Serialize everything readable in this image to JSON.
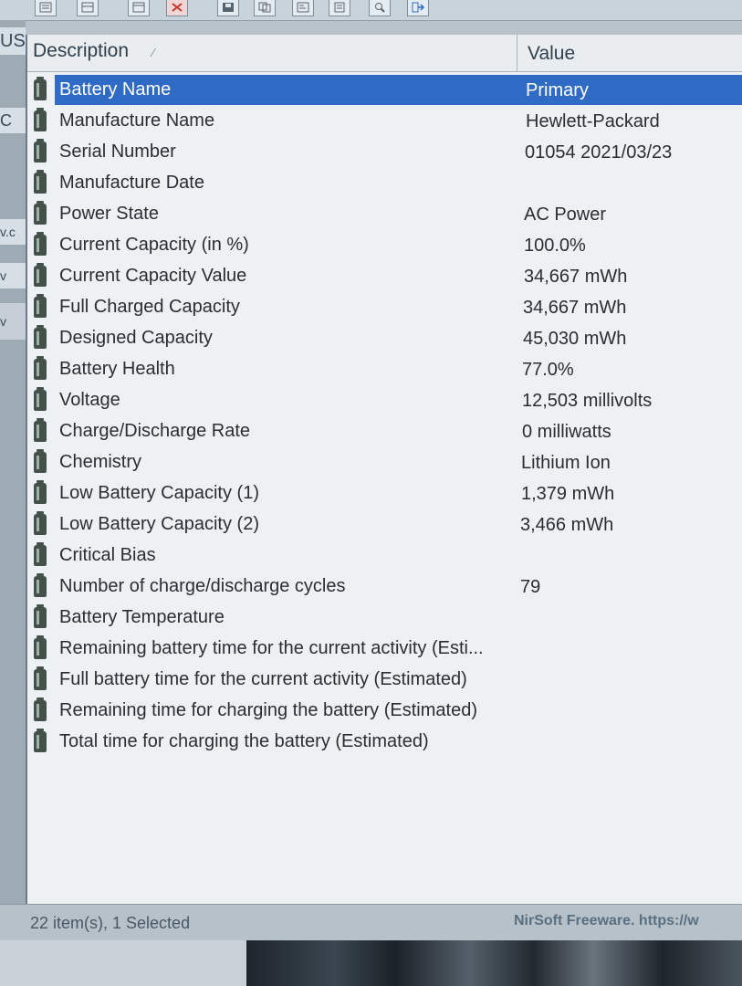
{
  "toolbar": {
    "icons": [
      "list-view-icon",
      "details-view-icon",
      "window-icon",
      "delete-icon",
      "save-icon",
      "copy-icon",
      "properties-icon",
      "report-icon",
      "find-icon",
      "exit-icon"
    ]
  },
  "background_window": {
    "fragments": [
      "US",
      "C",
      "v.c",
      "v",
      "v"
    ]
  },
  "columns": {
    "description": "Description",
    "value": "Value"
  },
  "rows": [
    {
      "description": "Battery Name",
      "value": "Primary",
      "selected": true
    },
    {
      "description": "Manufacture Name",
      "value": "Hewlett-Packard"
    },
    {
      "description": "Serial Number",
      "value": "01054 2021/03/23"
    },
    {
      "description": "Manufacture Date",
      "value": ""
    },
    {
      "description": "Power State",
      "value": "AC Power"
    },
    {
      "description": "Current Capacity (in %)",
      "value": "100.0%"
    },
    {
      "description": "Current Capacity Value",
      "value": "34,667 mWh"
    },
    {
      "description": "Full Charged Capacity",
      "value": "34,667 mWh"
    },
    {
      "description": "Designed Capacity",
      "value": "45,030 mWh"
    },
    {
      "description": "Battery Health",
      "value": "77.0%"
    },
    {
      "description": "Voltage",
      "value": "12,503 millivolts"
    },
    {
      "description": "Charge/Discharge Rate",
      "value": "0 milliwatts"
    },
    {
      "description": "Chemistry",
      "value": "Lithium Ion"
    },
    {
      "description": "Low Battery Capacity (1)",
      "value": "1,379 mWh"
    },
    {
      "description": "Low Battery Capacity (2)",
      "value": "3,466 mWh"
    },
    {
      "description": "Critical Bias",
      "value": ""
    },
    {
      "description": "Number of charge/discharge cycles",
      "value": "79"
    },
    {
      "description": "Battery Temperature",
      "value": ""
    },
    {
      "description": "Remaining battery time for the current activity (Esti...",
      "value": ""
    },
    {
      "description": "Full battery time for the current activity (Estimated)",
      "value": ""
    },
    {
      "description": "Remaining time for charging the battery (Estimated)",
      "value": ""
    },
    {
      "description": "Total  time for charging the battery (Estimated)",
      "value": ""
    }
  ],
  "status_bar": {
    "count": "22 item(s), 1 Selected",
    "credit": "NirSoft Freeware. https://w"
  },
  "colors": {
    "selection": "#2f6bc4",
    "list_background": "#eef1f3",
    "status_background": "#b7c1c9"
  }
}
